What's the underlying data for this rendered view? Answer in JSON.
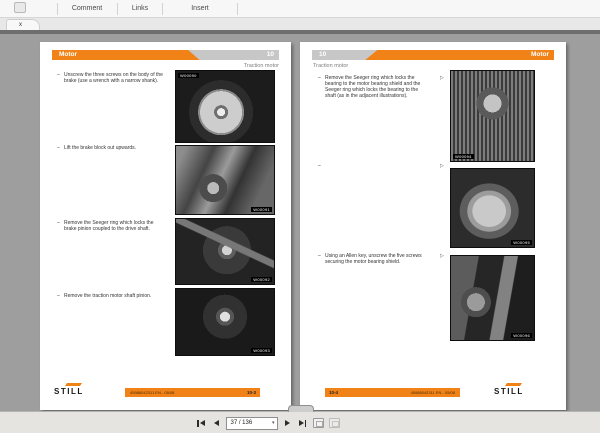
{
  "chars": {
    "bullet": "–",
    "arrow": "▷",
    "caret": "▾",
    "close": "x"
  },
  "toolbar": {
    "tabs": [
      {
        "label": "Comment"
      },
      {
        "label": "Links"
      },
      {
        "label": "Insert"
      }
    ]
  },
  "left_page": {
    "chapter_title": "Motor",
    "chapter_number": "10",
    "section_title": "Traction motor",
    "items": [
      {
        "text": "Unscrew the three screws on the body of the brake (use a wrench with a narrow shank)."
      },
      {
        "text": "Lift the brake block out upwards."
      },
      {
        "text": "Remove the Seeger ring which locks the brake pinion coupled to the drive shaft."
      },
      {
        "text": "Remove the traction motor shaft pinion."
      }
    ],
    "images": [
      {
        "code": "W00090"
      },
      {
        "code": "W00091"
      },
      {
        "code": "W00092"
      },
      {
        "code": "W00093"
      }
    ],
    "footer": {
      "brand": "STILL",
      "doc_code": "45988042311 EN - 05/08",
      "page_number": "10-3"
    }
  },
  "right_page": {
    "chapter_title": "Motor",
    "chapter_number": "10",
    "section_title": "Traction motor",
    "items": [
      {
        "text": "Remove the Seeger ring which locks the bearing to the motor bearing shield and the Seeger ring which locks the bearing to the shaft (as in the adjacent illustrations)."
      },
      {
        "text": ""
      },
      {
        "text": "Using an Allen key, unscrew the five screws securing the motor bearing shield."
      }
    ],
    "images": [
      {
        "code": "W00094"
      },
      {
        "code": "W00095"
      },
      {
        "code": "W00096"
      }
    ],
    "footer": {
      "brand": "STILL",
      "doc_code": "45988042311 EN - 05/08",
      "page_number": "10-4"
    }
  },
  "nav": {
    "page_indicator": "37 / 136"
  }
}
